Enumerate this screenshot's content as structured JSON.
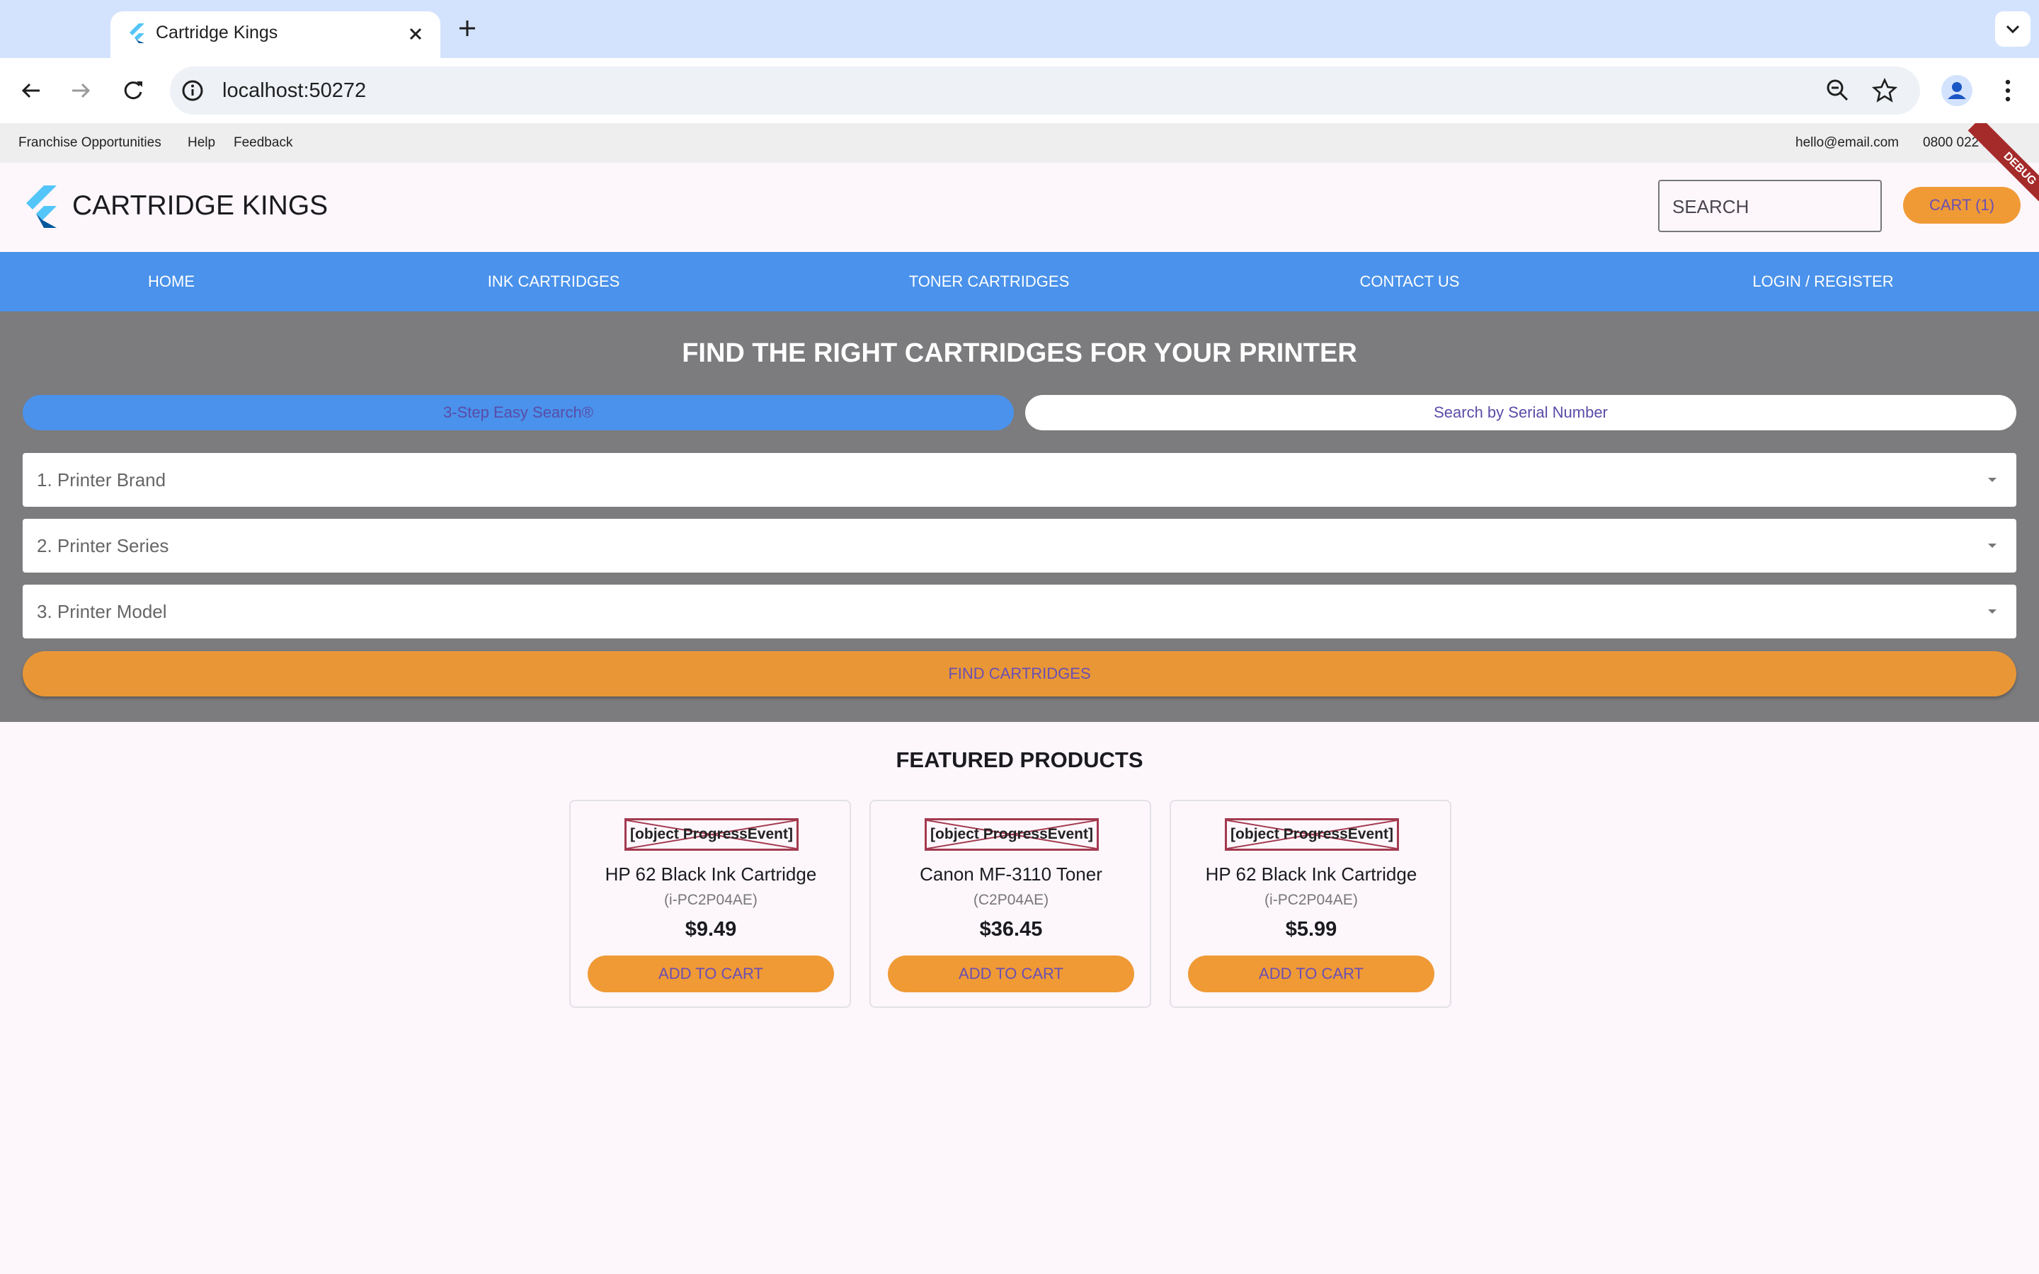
{
  "browser": {
    "tab_title": "Cartridge Kings",
    "url": "localhost:50272"
  },
  "topbar": {
    "links": [
      "Franchise Opportunities",
      "Help",
      "Feedback"
    ],
    "email": "hello@email.com",
    "phone": "0800 022 2"
  },
  "header": {
    "brand": "CARTRIDGE KINGS",
    "search_placeholder": "SEARCH",
    "cart_label": "CART (1)"
  },
  "nav": {
    "items": [
      "HOME",
      "INK CARTRIDGES",
      "TONER CARTRIDGES",
      "CONTACT US",
      "LOGIN / REGISTER"
    ]
  },
  "finder": {
    "title": "FIND THE RIGHT CARTRIDGES FOR YOUR PRINTER",
    "tabs": [
      "3-Step Easy Search®",
      "Search by Serial Number"
    ],
    "active_tab": "3-Step Easy Search®",
    "dropdowns": [
      "1. Printer Brand",
      "2. Printer Series",
      "3. Printer Model"
    ],
    "button": "FIND CARTRIDGES"
  },
  "featured": {
    "title": "FEATURED PRODUCTS",
    "products": [
      {
        "image_alt": "[object ProgressEvent]",
        "name": "HP 62 Black Ink Cartridge",
        "sku": "(i-PC2P04AE)",
        "price": "$9.49",
        "button": "ADD TO CART"
      },
      {
        "image_alt": "[object ProgressEvent]",
        "name": "Canon MF-3110 Toner",
        "sku": "(C2P04AE)",
        "price": "$36.45",
        "button": "ADD TO CART"
      },
      {
        "image_alt": "[object ProgressEvent]",
        "name": "HP 62 Black Ink Cartridge",
        "sku": "(i-PC2P04AE)",
        "price": "$5.99",
        "button": "ADD TO CART"
      }
    ]
  },
  "debug_banner": "DEBUG",
  "colors": {
    "nav_blue": "#4a92eb",
    "accent_orange": "#f09a36",
    "finder_gray": "#7c7b7d",
    "button_text": "#6a4fb3"
  },
  "icons": [
    "flutter-logo-icon",
    "close-icon",
    "plus-icon",
    "chevron-down-icon",
    "back-icon",
    "forward-icon",
    "reload-icon",
    "info-icon",
    "zoom-icon",
    "star-icon",
    "profile-icon",
    "kebab-icon",
    "caret-down-icon"
  ]
}
